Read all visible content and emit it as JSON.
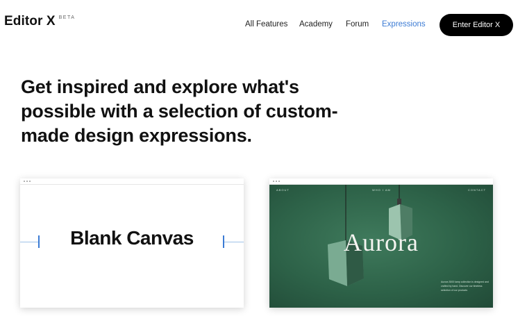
{
  "header": {
    "logo_text": "Editor X",
    "logo_badge": "BETA",
    "nav": [
      {
        "label": "All Features",
        "active": false
      },
      {
        "label": "Academy",
        "active": false
      },
      {
        "label": "Forum",
        "active": false
      },
      {
        "label": "Expressions",
        "active": true
      }
    ],
    "cta_label": "Enter Editor X"
  },
  "hero": {
    "line1": "Get inspired and explore what's",
    "line2": "possible with a selection of custom-",
    "line3": "made design expressions."
  },
  "cards": [
    {
      "title": "Blank Canvas"
    },
    {
      "title": "Aurora",
      "nav": [
        "ABOUT",
        "WHO I AM",
        "CONTACT"
      ],
      "caption": "Aurora 3000 lamp collection is designed and crafted by hand. Discover our timeless selection of our products"
    }
  ],
  "colors": {
    "accent": "#3b7bd4",
    "cta_background": "#000000",
    "aurora_green": "#2d6248"
  }
}
